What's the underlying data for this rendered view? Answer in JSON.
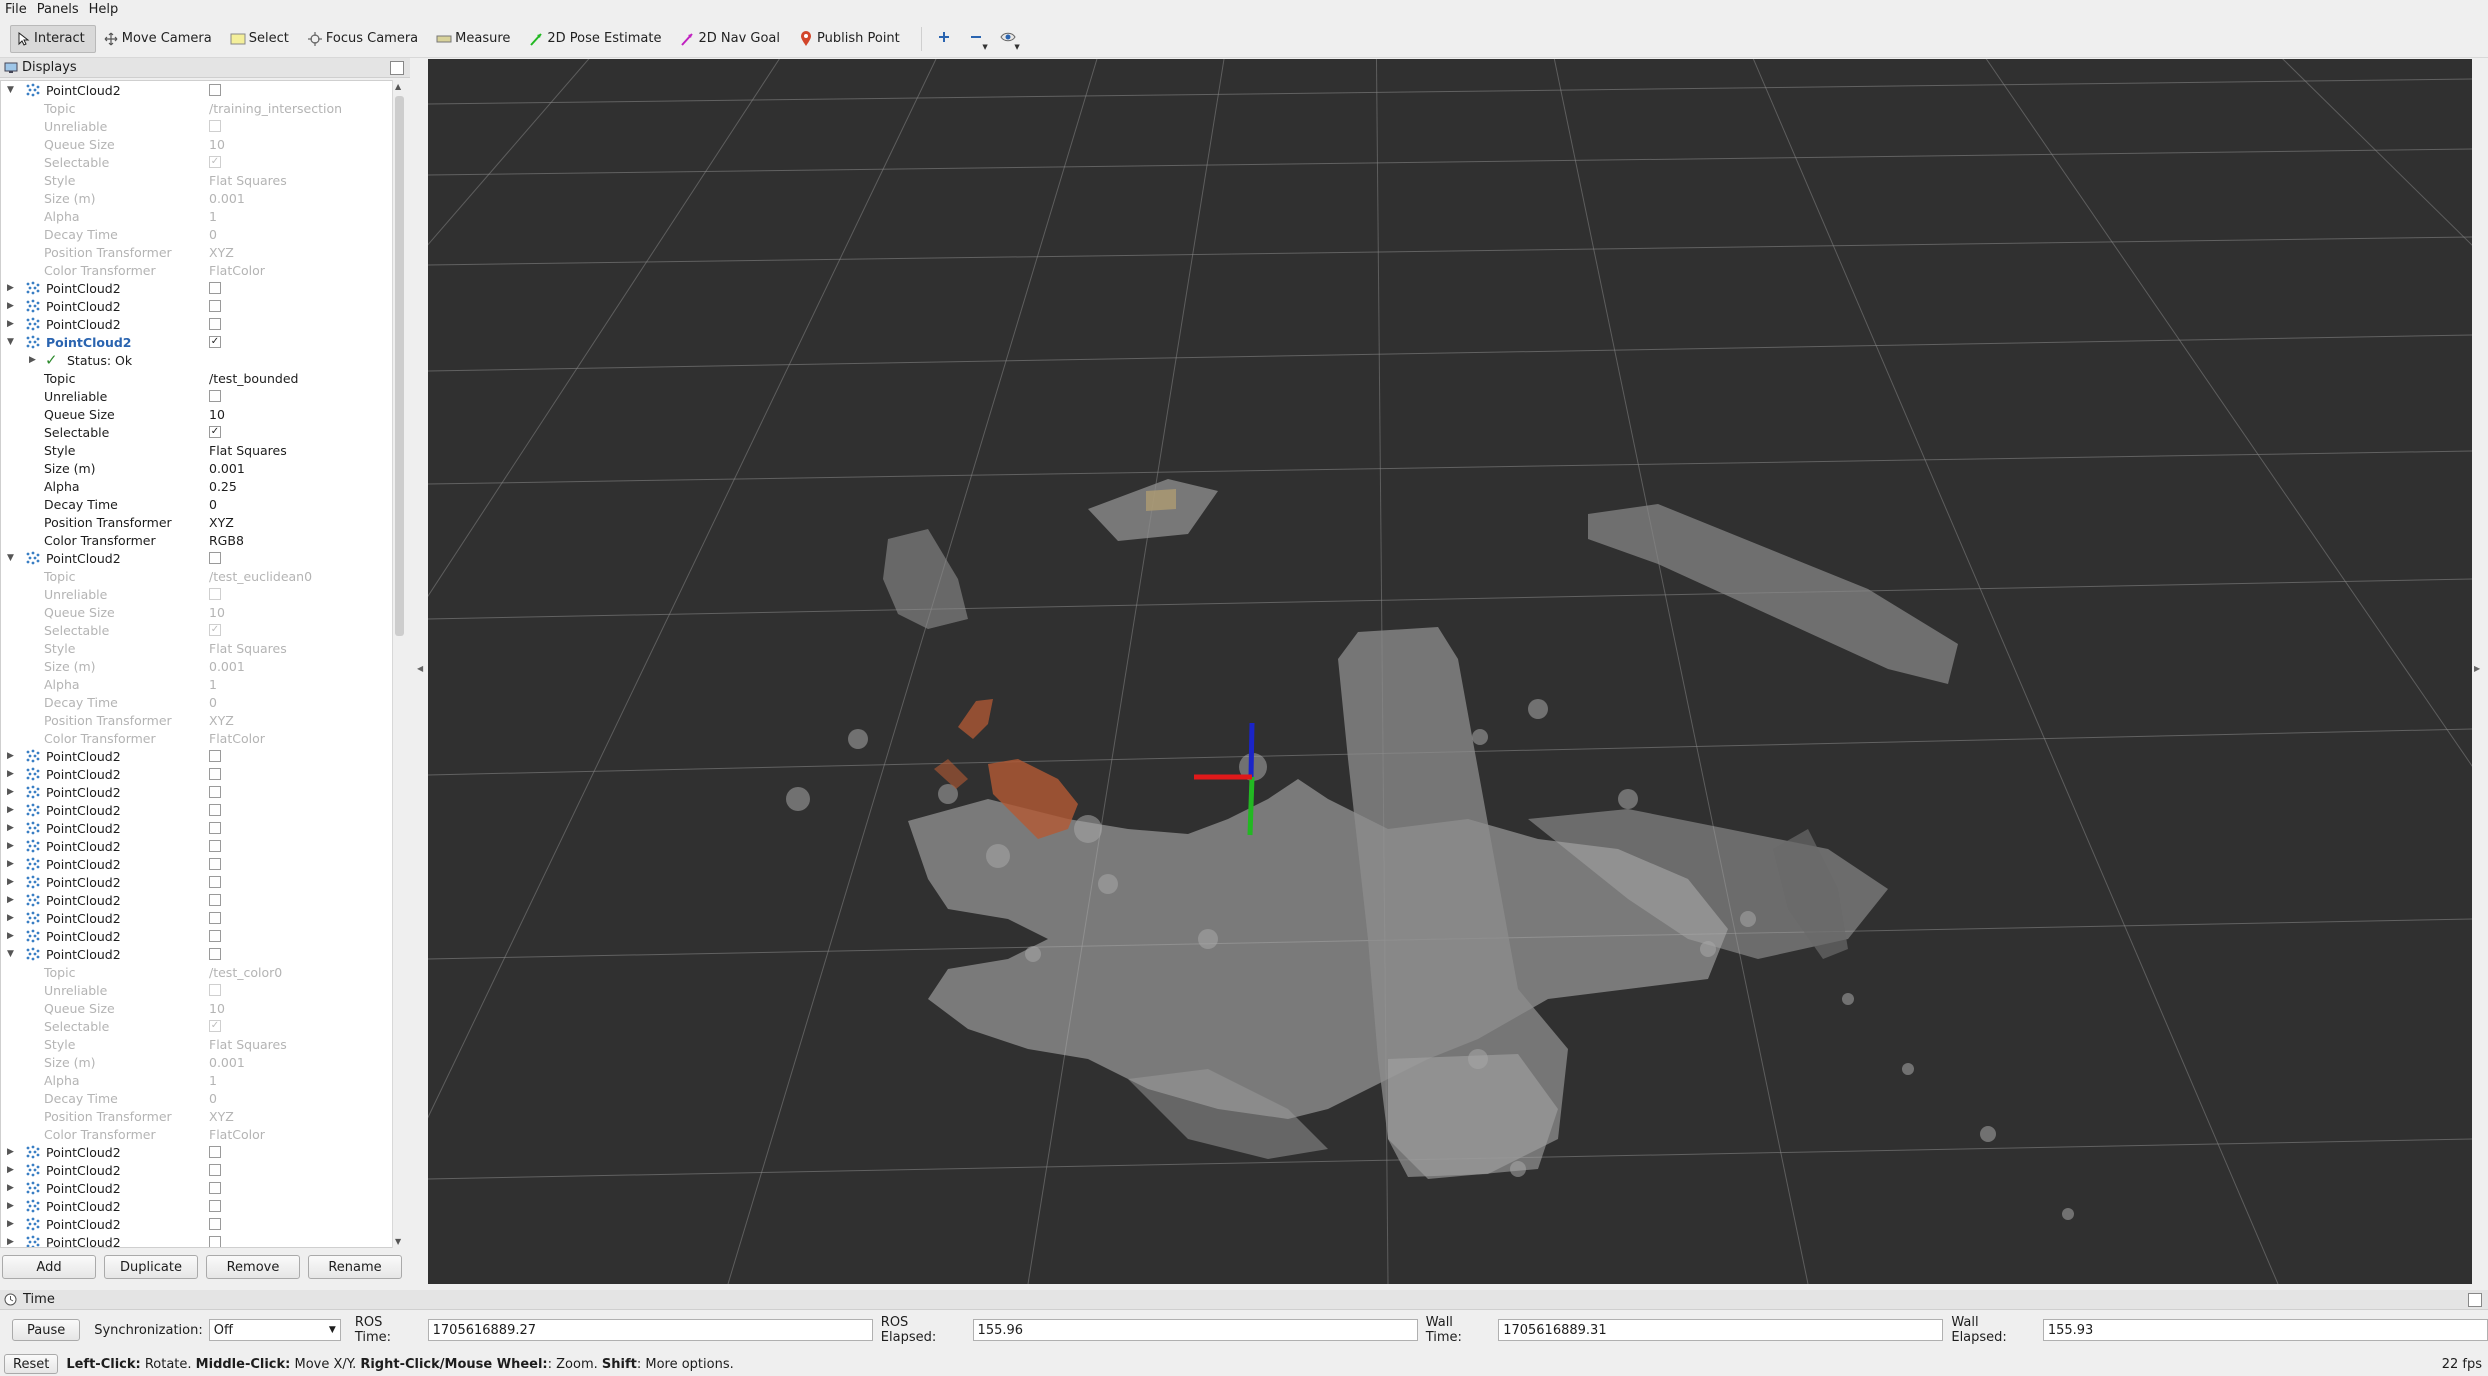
{
  "menubar": {
    "items": [
      {
        "label": "File"
      },
      {
        "label": "Panels"
      },
      {
        "label": "Help"
      }
    ]
  },
  "toolbar": {
    "tools": [
      {
        "label": "Interact",
        "icon": "cursor-icon",
        "active": true
      },
      {
        "label": "Move Camera",
        "icon": "move-camera-icon"
      },
      {
        "label": "Select",
        "icon": "select-icon"
      },
      {
        "label": "Focus Camera",
        "icon": "focus-camera-icon"
      },
      {
        "label": "Measure",
        "icon": "measure-icon"
      },
      {
        "label": "2D Pose Estimate",
        "icon": "pose-estimate-icon"
      },
      {
        "label": "2D Nav Goal",
        "icon": "nav-goal-icon"
      },
      {
        "label": "Publish Point",
        "icon": "publish-point-icon"
      }
    ]
  },
  "displays": {
    "title": "Displays",
    "expanded_props_dim": [
      {
        "label": "Topic",
        "value": ""
      },
      {
        "label": "Unreliable",
        "check": false
      },
      {
        "label": "Queue Size",
        "value": "10"
      },
      {
        "label": "Selectable",
        "check": true
      },
      {
        "label": "Style",
        "value": "Flat Squares"
      },
      {
        "label": "Size (m)",
        "value": "0.001"
      },
      {
        "label": "Alpha",
        "value": "1"
      },
      {
        "label": "Decay Time",
        "value": "0"
      },
      {
        "label": "Position Transformer",
        "value": "XYZ"
      },
      {
        "label": "Color Transformer",
        "value": "FlatColor"
      }
    ],
    "rows": [
      {
        "kind": "display",
        "name": "PointCloud2",
        "expanded": true,
        "checked": false
      },
      {
        "kind": "prop",
        "dim": true,
        "label": "Topic",
        "value": "/training_intersection"
      },
      {
        "kind": "prop",
        "dim": true,
        "label": "Unreliable",
        "check": false
      },
      {
        "kind": "prop",
        "dim": true,
        "label": "Queue Size",
        "value": "10"
      },
      {
        "kind": "prop",
        "dim": true,
        "label": "Selectable",
        "check": true
      },
      {
        "kind": "prop",
        "dim": true,
        "label": "Style",
        "value": "Flat Squares"
      },
      {
        "kind": "prop",
        "dim": true,
        "label": "Size (m)",
        "value": "0.001"
      },
      {
        "kind": "prop",
        "dim": true,
        "label": "Alpha",
        "value": "1"
      },
      {
        "kind": "prop",
        "dim": true,
        "label": "Decay Time",
        "value": "0"
      },
      {
        "kind": "prop",
        "dim": true,
        "label": "Position Transformer",
        "value": "XYZ"
      },
      {
        "kind": "prop",
        "dim": true,
        "label": "Color Transformer",
        "value": "FlatColor"
      },
      {
        "kind": "display",
        "name": "PointCloud2",
        "expanded": false,
        "checked": false
      },
      {
        "kind": "display",
        "name": "PointCloud2",
        "expanded": false,
        "checked": false
      },
      {
        "kind": "display",
        "name": "PointCloud2",
        "expanded": false,
        "checked": false
      },
      {
        "kind": "display",
        "name": "PointCloud2",
        "expanded": true,
        "checked": true,
        "selected": true
      },
      {
        "kind": "status",
        "label": "Status: Ok"
      },
      {
        "kind": "prop",
        "dim": false,
        "label": "Topic",
        "value": "/test_bounded"
      },
      {
        "kind": "prop",
        "dim": false,
        "label": "Unreliable",
        "check": false
      },
      {
        "kind": "prop",
        "dim": false,
        "label": "Queue Size",
        "value": "10"
      },
      {
        "kind": "prop",
        "dim": false,
        "label": "Selectable",
        "check": true
      },
      {
        "kind": "prop",
        "dim": false,
        "label": "Style",
        "value": "Flat Squares"
      },
      {
        "kind": "prop",
        "dim": false,
        "label": "Size (m)",
        "value": "0.001"
      },
      {
        "kind": "prop",
        "dim": false,
        "label": "Alpha",
        "value": "0.25"
      },
      {
        "kind": "prop",
        "dim": false,
        "label": "Decay Time",
        "value": "0"
      },
      {
        "kind": "prop",
        "dim": false,
        "label": "Position Transformer",
        "value": "XYZ"
      },
      {
        "kind": "prop",
        "dim": false,
        "label": "Color Transformer",
        "value": "RGB8"
      },
      {
        "kind": "display",
        "name": "PointCloud2",
        "expanded": true,
        "checked": false
      },
      {
        "kind": "prop",
        "dim": true,
        "label": "Topic",
        "value": "/test_euclidean0"
      },
      {
        "kind": "prop",
        "dim": true,
        "label": "Unreliable",
        "check": false
      },
      {
        "kind": "prop",
        "dim": true,
        "label": "Queue Size",
        "value": "10"
      },
      {
        "kind": "prop",
        "dim": true,
        "label": "Selectable",
        "check": true
      },
      {
        "kind": "prop",
        "dim": true,
        "label": "Style",
        "value": "Flat Squares"
      },
      {
        "kind": "prop",
        "dim": true,
        "label": "Size (m)",
        "value": "0.001"
      },
      {
        "kind": "prop",
        "dim": true,
        "label": "Alpha",
        "value": "1"
      },
      {
        "kind": "prop",
        "dim": true,
        "label": "Decay Time",
        "value": "0"
      },
      {
        "kind": "prop",
        "dim": true,
        "label": "Position Transformer",
        "value": "XYZ"
      },
      {
        "kind": "prop",
        "dim": true,
        "label": "Color Transformer",
        "value": "FlatColor"
      },
      {
        "kind": "display",
        "name": "PointCloud2",
        "expanded": false,
        "checked": false
      },
      {
        "kind": "display",
        "name": "PointCloud2",
        "expanded": false,
        "checked": false
      },
      {
        "kind": "display",
        "name": "PointCloud2",
        "expanded": false,
        "checked": false
      },
      {
        "kind": "display",
        "name": "PointCloud2",
        "expanded": false,
        "checked": false
      },
      {
        "kind": "display",
        "name": "PointCloud2",
        "expanded": false,
        "checked": false
      },
      {
        "kind": "display",
        "name": "PointCloud2",
        "expanded": false,
        "checked": false
      },
      {
        "kind": "display",
        "name": "PointCloud2",
        "expanded": false,
        "checked": false
      },
      {
        "kind": "display",
        "name": "PointCloud2",
        "expanded": false,
        "checked": false
      },
      {
        "kind": "display",
        "name": "PointCloud2",
        "expanded": false,
        "checked": false
      },
      {
        "kind": "display",
        "name": "PointCloud2",
        "expanded": false,
        "checked": false
      },
      {
        "kind": "display",
        "name": "PointCloud2",
        "expanded": false,
        "checked": false
      },
      {
        "kind": "display",
        "name": "PointCloud2",
        "expanded": true,
        "checked": false
      },
      {
        "kind": "prop",
        "dim": true,
        "label": "Topic",
        "value": "/test_color0"
      },
      {
        "kind": "prop",
        "dim": true,
        "label": "Unreliable",
        "check": false
      },
      {
        "kind": "prop",
        "dim": true,
        "label": "Queue Size",
        "value": "10"
      },
      {
        "kind": "prop",
        "dim": true,
        "label": "Selectable",
        "check": true
      },
      {
        "kind": "prop",
        "dim": true,
        "label": "Style",
        "value": "Flat Squares"
      },
      {
        "kind": "prop",
        "dim": true,
        "label": "Size (m)",
        "value": "0.001"
      },
      {
        "kind": "prop",
        "dim": true,
        "label": "Alpha",
        "value": "1"
      },
      {
        "kind": "prop",
        "dim": true,
        "label": "Decay Time",
        "value": "0"
      },
      {
        "kind": "prop",
        "dim": true,
        "label": "Position Transformer",
        "value": "XYZ"
      },
      {
        "kind": "prop",
        "dim": true,
        "label": "Color Transformer",
        "value": "FlatColor"
      },
      {
        "kind": "display",
        "name": "PointCloud2",
        "expanded": false,
        "checked": false
      },
      {
        "kind": "display",
        "name": "PointCloud2",
        "expanded": false,
        "checked": false
      },
      {
        "kind": "display",
        "name": "PointCloud2",
        "expanded": false,
        "checked": false
      },
      {
        "kind": "display",
        "name": "PointCloud2",
        "expanded": false,
        "checked": false
      },
      {
        "kind": "display",
        "name": "PointCloud2",
        "expanded": false,
        "checked": false
      },
      {
        "kind": "display",
        "name": "PointCloud2",
        "expanded": false,
        "checked": false
      }
    ],
    "buttons": {
      "add": "Add",
      "duplicate": "Duplicate",
      "remove": "Remove",
      "rename": "Rename"
    }
  },
  "time": {
    "title": "Time",
    "pause_label": "Pause",
    "sync_label": "Synchronization:",
    "sync_value": "Off",
    "ros_time_label": "ROS Time:",
    "ros_time_value": "1705616889.27",
    "ros_elapsed_label": "ROS Elapsed:",
    "ros_elapsed_value": "155.96",
    "wall_time_label": "Wall Time:",
    "wall_time_value": "1705616889.31",
    "wall_elapsed_label": "Wall Elapsed:",
    "wall_elapsed_value": "155.93"
  },
  "status": {
    "reset_label": "Reset",
    "hint_parts": [
      {
        "text": "Left-Click:",
        "bold": true
      },
      {
        "text": " Rotate. ",
        "bold": false
      },
      {
        "text": "Middle-Click:",
        "bold": true
      },
      {
        "text": " Move X/Y. ",
        "bold": false
      },
      {
        "text": "Right-Click/Mouse Wheel:",
        "bold": true
      },
      {
        "text": ": Zoom. ",
        "bold": false
      },
      {
        "text": "Shift",
        "bold": true
      },
      {
        "text": ": More options.",
        "bold": false
      }
    ],
    "fps": "22 fps"
  },
  "colors": {
    "viewport_bg": "#303030",
    "grid": "#8a8a8a",
    "axis_x": "#e0191a",
    "axis_y": "#22b822",
    "axis_z": "#1a24c8",
    "selected_text": "#2a64b0",
    "highlight_cloud": "#b45a34"
  }
}
